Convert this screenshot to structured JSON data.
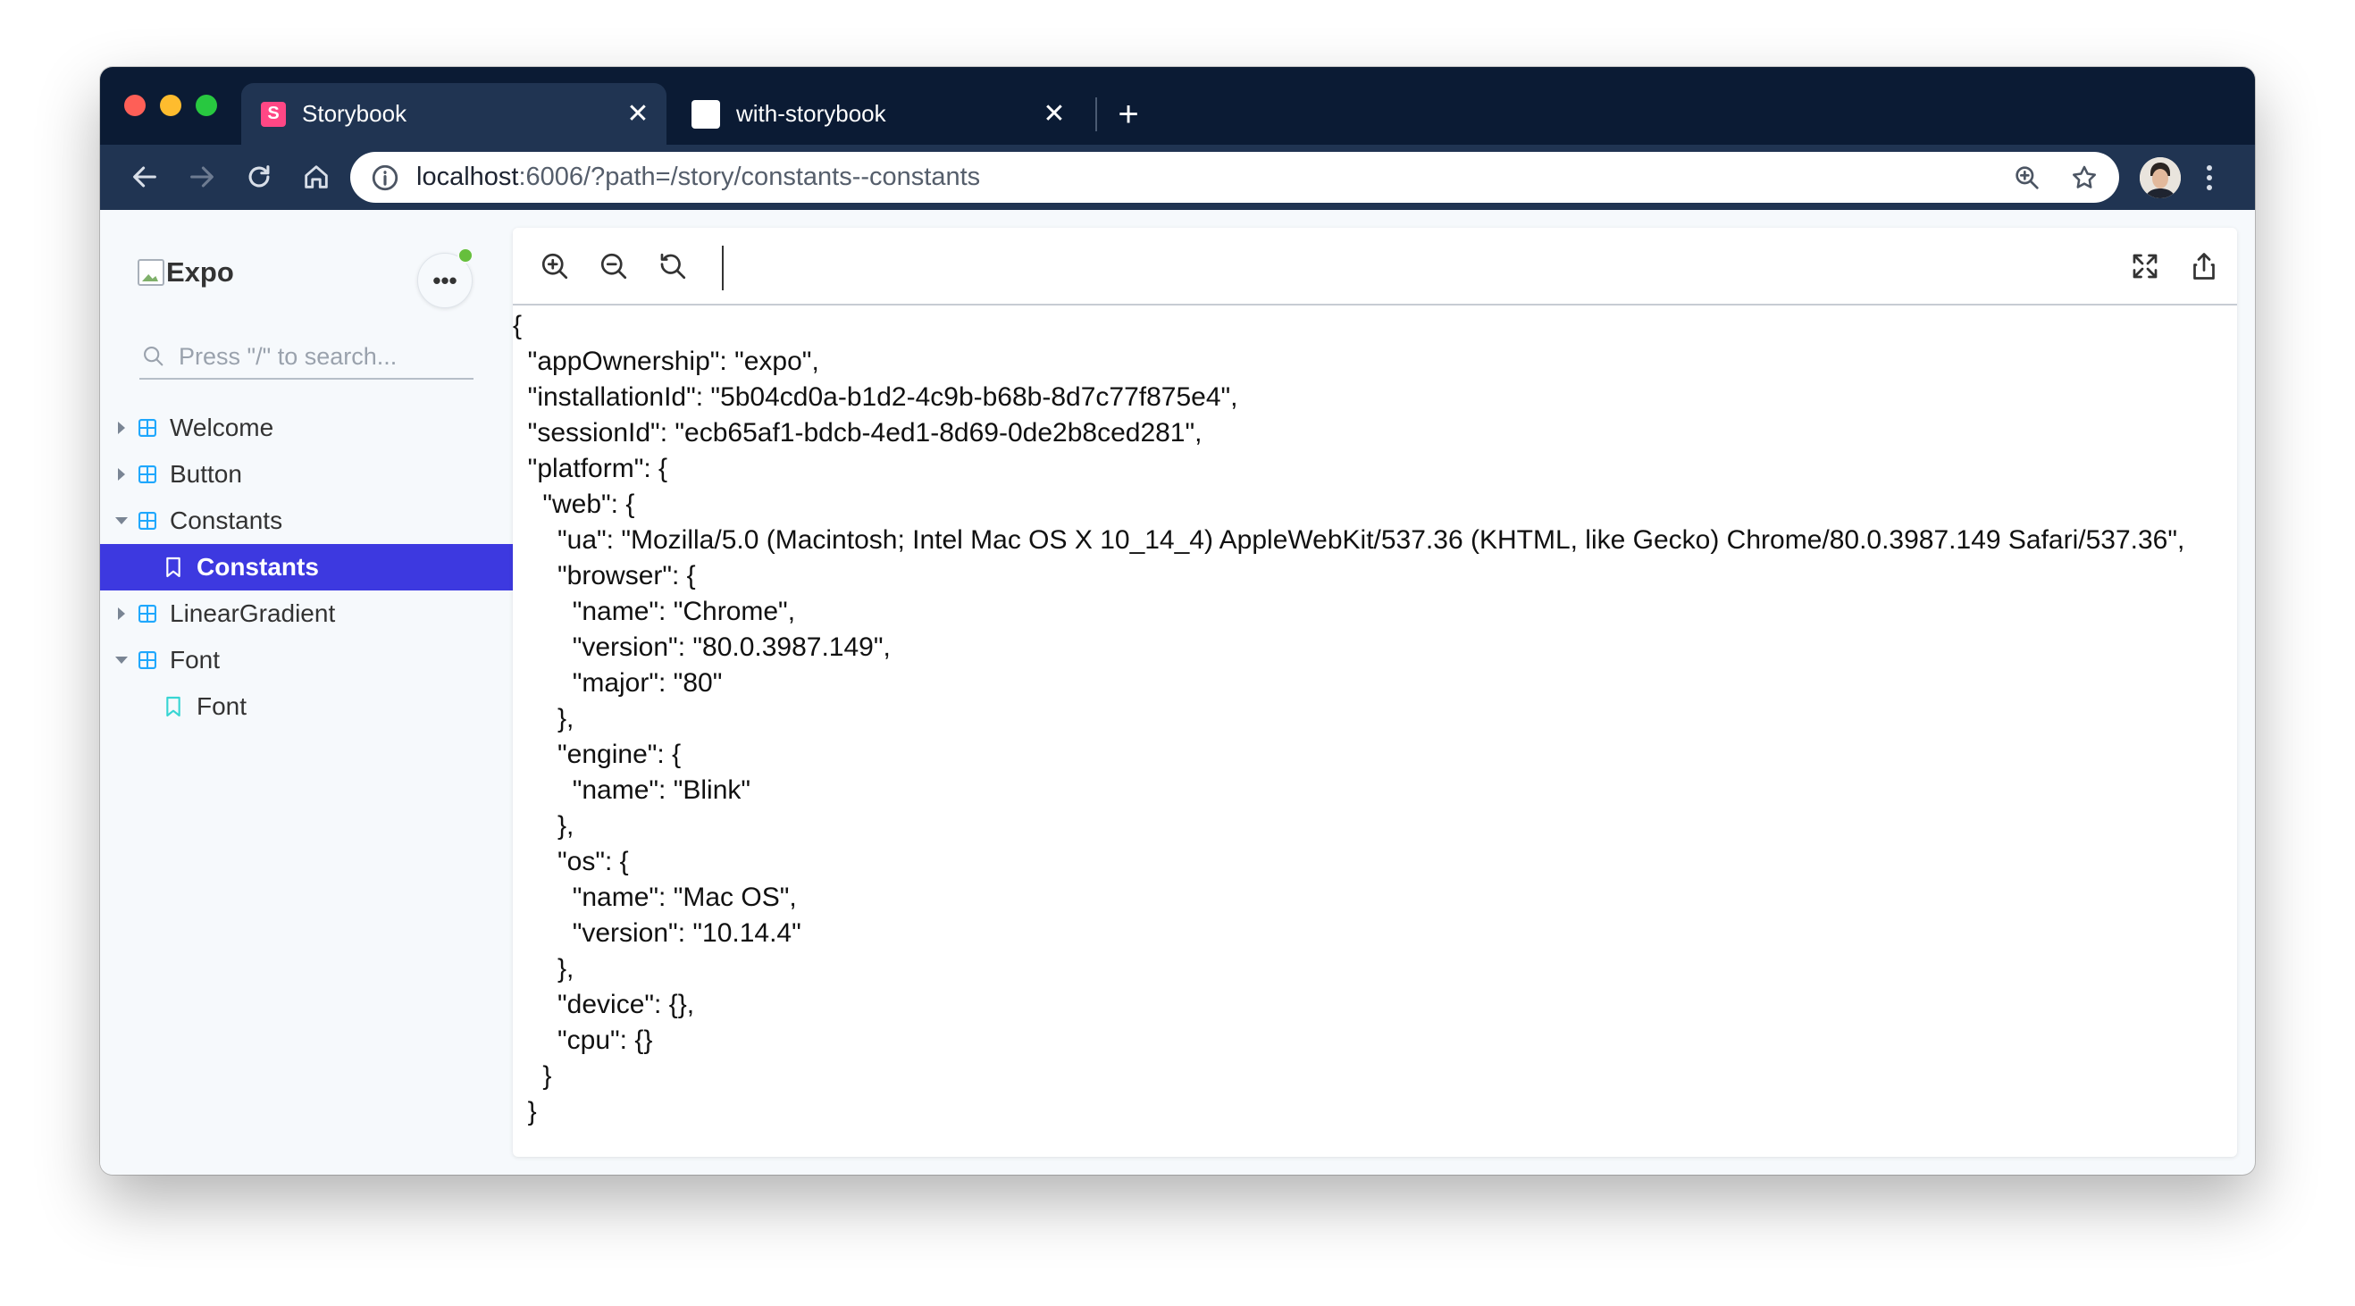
{
  "browser": {
    "tabs": [
      {
        "title": "Storybook",
        "favicon": "storybook-icon",
        "active": true
      },
      {
        "title": "with-storybook",
        "favicon": "blank-page-icon",
        "active": false
      }
    ],
    "close_glyph": "✕",
    "new_tab_glyph": "+",
    "url": {
      "host": "localhost",
      "rest": ":6006/?path=/story/constants--constants"
    },
    "favicon_letter": "S"
  },
  "sidebar": {
    "brand": "Expo",
    "more_glyph": "•••",
    "search": {
      "placeholder": "Press \"/\" to search..."
    },
    "items": [
      {
        "label": "Welcome",
        "type": "component",
        "expanded": false
      },
      {
        "label": "Button",
        "type": "component",
        "expanded": false
      },
      {
        "label": "Constants",
        "type": "component",
        "expanded": true
      },
      {
        "label": "Constants",
        "type": "story",
        "selected": true
      },
      {
        "label": "LinearGradient",
        "type": "component",
        "expanded": false
      },
      {
        "label": "Font",
        "type": "component",
        "expanded": true
      },
      {
        "label": "Font",
        "type": "story",
        "selected": false
      }
    ]
  },
  "preview": {
    "content": "{\n  \"appOwnership\": \"expo\",\n  \"installationId\": \"5b04cd0a-b1d2-4c9b-b68b-8d7c77f875e4\",\n  \"sessionId\": \"ecb65af1-bdcb-4ed1-8d69-0de2b8ced281\",\n  \"platform\": {\n    \"web\": {\n      \"ua\": \"Mozilla/5.0 (Macintosh; Intel Mac OS X 10_14_4) AppleWebKit/537.36 (KHTML, like Gecko) Chrome/80.0.3987.149 Safari/537.36\",\n      \"browser\": {\n        \"name\": \"Chrome\",\n        \"version\": \"80.0.3987.149\",\n        \"major\": \"80\"\n      },\n      \"engine\": {\n        \"name\": \"Blink\"\n      },\n      \"os\": {\n        \"name\": \"Mac OS\",\n        \"version\": \"10.14.4\"\n      },\n      \"device\": {},\n      \"cpu\": {}\n    }\n  }"
  },
  "colors": {
    "titlebar": "#0b1b34",
    "toolbar": "#203452",
    "selected": "#3d39e0",
    "component_icon": "#1ea7fd",
    "story_icon": "#37d5d3",
    "status_dot": "#66bf3c"
  }
}
